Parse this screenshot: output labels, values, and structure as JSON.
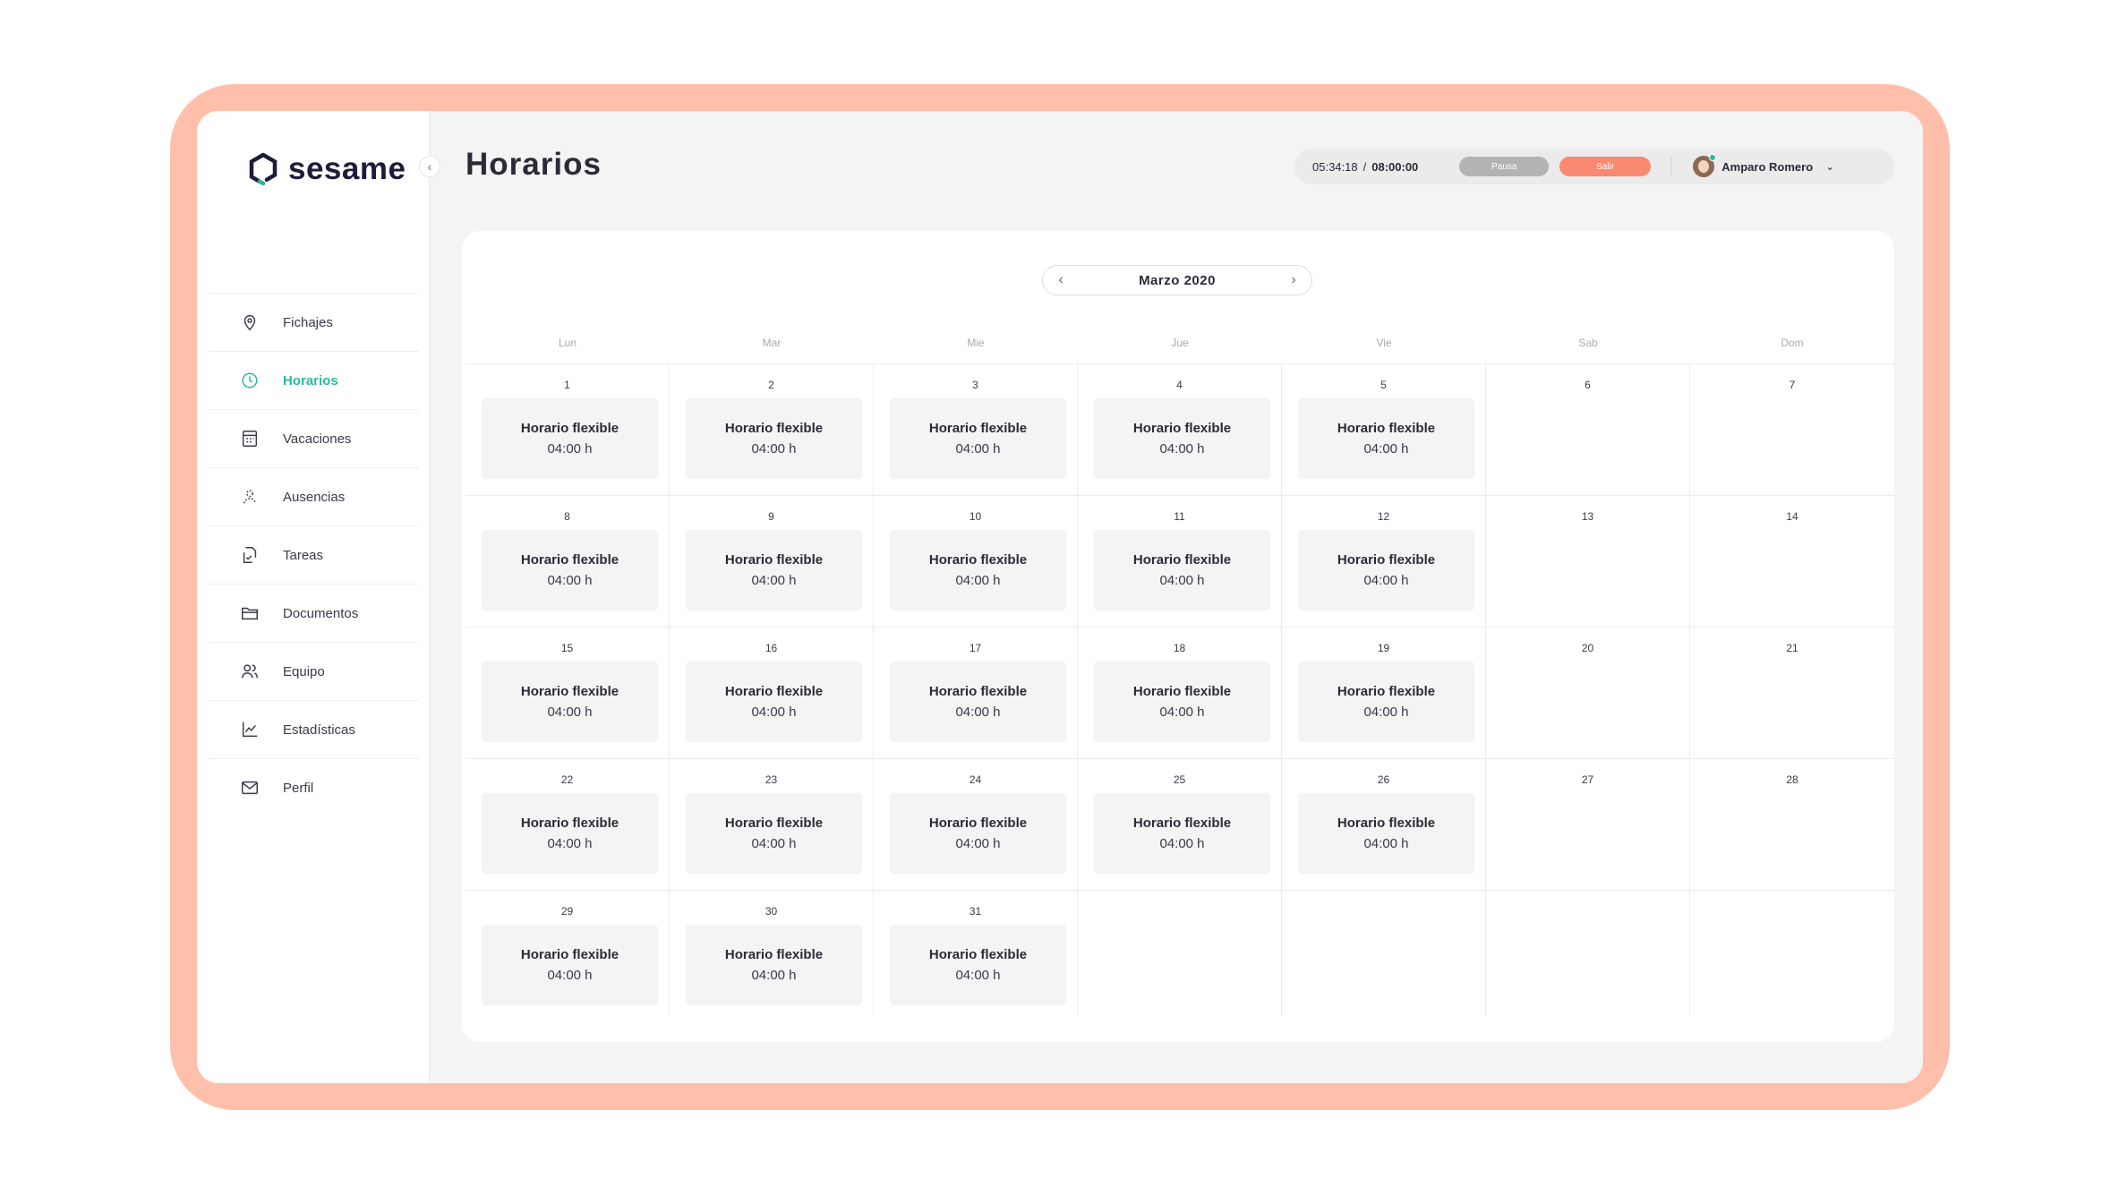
{
  "app": {
    "logo_text": "sesame",
    "page_title": "Horarios"
  },
  "colors": {
    "frame": "#ffbfaa",
    "accent_active": "#2fb79d",
    "salir_button": "#f98970",
    "pausa_button": "#b3b3b3"
  },
  "sidebar": {
    "items": [
      {
        "label": "Fichajes",
        "icon": "location-pin-icon",
        "active": false
      },
      {
        "label": "Horarios",
        "icon": "clock-icon",
        "active": true
      },
      {
        "label": "Vacaciones",
        "icon": "calendar-icon",
        "active": false
      },
      {
        "label": "Ausencias",
        "icon": "absence-icon",
        "active": false
      },
      {
        "label": "Tareas",
        "icon": "tasks-icon",
        "active": false
      },
      {
        "label": "Documentos",
        "icon": "folder-icon",
        "active": false
      },
      {
        "label": "Equipo",
        "icon": "team-icon",
        "active": false
      },
      {
        "label": "Estadísticas",
        "icon": "chart-icon",
        "active": false
      },
      {
        "label": "Perfil",
        "icon": "envelope-icon",
        "active": false
      }
    ]
  },
  "topbar": {
    "elapsed": "05:34:18",
    "separator": "/",
    "total": "08:00:00",
    "pause_label": "Pausa",
    "exit_label": "Salir",
    "user_name": "Amparo Romero"
  },
  "calendar": {
    "month_label": "Marzo 2020",
    "weekdays": [
      "Lun",
      "Mar",
      "Mie",
      "Jue",
      "Vie",
      "Sab",
      "Dom"
    ],
    "weeks": [
      [
        {
          "day": "1",
          "shift": "Horario flexible",
          "hours": "04:00 h"
        },
        {
          "day": "2",
          "shift": "Horario flexible",
          "hours": "04:00 h"
        },
        {
          "day": "3",
          "shift": "Horario flexible",
          "hours": "04:00 h"
        },
        {
          "day": "4",
          "shift": "Horario flexible",
          "hours": "04:00 h"
        },
        {
          "day": "5",
          "shift": "Horario flexible",
          "hours": "04:00 h"
        },
        {
          "day": "6"
        },
        {
          "day": "7"
        }
      ],
      [
        {
          "day": "8",
          "shift": "Horario flexible",
          "hours": "04:00 h"
        },
        {
          "day": "9",
          "shift": "Horario flexible",
          "hours": "04:00 h"
        },
        {
          "day": "10",
          "shift": "Horario flexible",
          "hours": "04:00 h"
        },
        {
          "day": "11",
          "shift": "Horario flexible",
          "hours": "04:00 h"
        },
        {
          "day": "12",
          "shift": "Horario flexible",
          "hours": "04:00 h"
        },
        {
          "day": "13"
        },
        {
          "day": "14"
        }
      ],
      [
        {
          "day": "15",
          "shift": "Horario flexible",
          "hours": "04:00 h"
        },
        {
          "day": "16",
          "shift": "Horario flexible",
          "hours": "04:00 h"
        },
        {
          "day": "17",
          "shift": "Horario flexible",
          "hours": "04:00 h"
        },
        {
          "day": "18",
          "shift": "Horario flexible",
          "hours": "04:00 h"
        },
        {
          "day": "19",
          "shift": "Horario flexible",
          "hours": "04:00 h"
        },
        {
          "day": "20"
        },
        {
          "day": "21"
        }
      ],
      [
        {
          "day": "22",
          "shift": "Horario flexible",
          "hours": "04:00 h"
        },
        {
          "day": "23",
          "shift": "Horario flexible",
          "hours": "04:00 h"
        },
        {
          "day": "24",
          "shift": "Horario flexible",
          "hours": "04:00 h"
        },
        {
          "day": "25",
          "shift": "Horario flexible",
          "hours": "04:00 h"
        },
        {
          "day": "26",
          "shift": "Horario flexible",
          "hours": "04:00 h"
        },
        {
          "day": "27"
        },
        {
          "day": "28"
        }
      ],
      [
        {
          "day": "29",
          "shift": "Horario flexible",
          "hours": "04:00 h"
        },
        {
          "day": "30",
          "shift": "Horario flexible",
          "hours": "04:00 h"
        },
        {
          "day": "31",
          "shift": "Horario flexible",
          "hours": "04:00 h"
        },
        {
          "day": ""
        },
        {
          "day": ""
        },
        {
          "day": ""
        },
        {
          "day": ""
        }
      ]
    ]
  }
}
